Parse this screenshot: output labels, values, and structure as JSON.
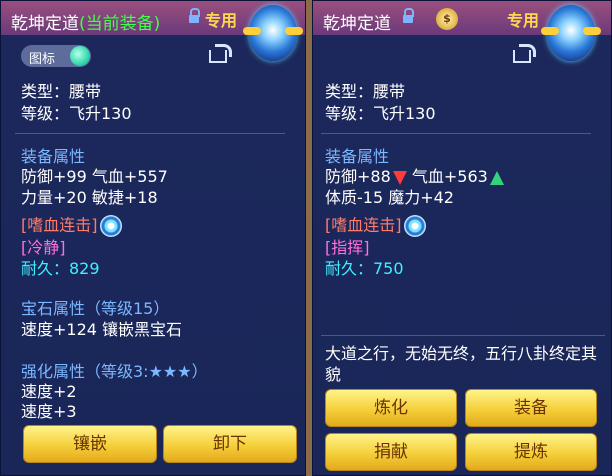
{
  "left": {
    "name": "乾坤定道",
    "tag_current": "(当前装备)",
    "tag_exclusive": "专用",
    "toggle_label": "图标",
    "type_line": "类型：腰带",
    "level_line": "等级：飞升130",
    "attr_header": "装备属性",
    "attr_line1": "防御+99 气血+557",
    "attr_line2": "力量+20 敏捷+18",
    "skill1": "[嗜血连击]",
    "skill2": "[冷静]",
    "durability": "耐久：829",
    "gem_header": "宝石属性（等级15）",
    "gem_line": "速度+124 镶嵌黑宝石",
    "enhance_header": "强化属性（等级3:★★★）",
    "enhance_line1": "速度+2",
    "enhance_line2": "速度+3",
    "buttons": {
      "inlay": "镶嵌",
      "unequip": "卸下"
    }
  },
  "right": {
    "name": "乾坤定道",
    "coin_glyph": "$",
    "tag_exclusive": "专用",
    "type_line": "类型：腰带",
    "level_line": "等级：飞升130",
    "attr_header": "装备属性",
    "attr_def": "防御+88",
    "attr_hp": "气血+563",
    "attr_line2": "体质-15 魔力+42",
    "skill1": "[嗜血连击]",
    "skill2": "[指挥]",
    "durability": "耐久：750",
    "description": "大道之行，无始无终，五行八卦终定其貌",
    "buttons": {
      "refine": "炼化",
      "equip": "装备",
      "donate": "捐献",
      "extract": "提炼"
    }
  },
  "colors": {
    "header": "#7ab8ff",
    "skill_red": "#ff7a6a",
    "skill_pink": "#ff6fe0",
    "durability": "#3ff0ff",
    "current_tag": "#3fff4a",
    "exclusive": "#ffd94a"
  },
  "icons": [
    "lock-icon",
    "share-icon",
    "equipment-emblem-icon",
    "swirl-skill-icon",
    "arrow-up-icon",
    "arrow-down-icon",
    "coin-icon",
    "toggle-knob"
  ]
}
